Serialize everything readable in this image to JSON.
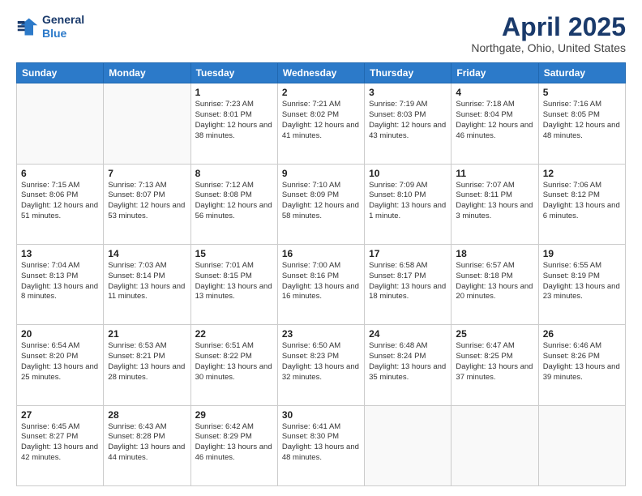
{
  "header": {
    "logo_line1": "General",
    "logo_line2": "Blue",
    "month": "April 2025",
    "location": "Northgate, Ohio, United States"
  },
  "weekdays": [
    "Sunday",
    "Monday",
    "Tuesday",
    "Wednesday",
    "Thursday",
    "Friday",
    "Saturday"
  ],
  "weeks": [
    [
      {
        "day": "",
        "info": ""
      },
      {
        "day": "",
        "info": ""
      },
      {
        "day": "1",
        "info": "Sunrise: 7:23 AM\nSunset: 8:01 PM\nDaylight: 12 hours and 38 minutes."
      },
      {
        "day": "2",
        "info": "Sunrise: 7:21 AM\nSunset: 8:02 PM\nDaylight: 12 hours and 41 minutes."
      },
      {
        "day": "3",
        "info": "Sunrise: 7:19 AM\nSunset: 8:03 PM\nDaylight: 12 hours and 43 minutes."
      },
      {
        "day": "4",
        "info": "Sunrise: 7:18 AM\nSunset: 8:04 PM\nDaylight: 12 hours and 46 minutes."
      },
      {
        "day": "5",
        "info": "Sunrise: 7:16 AM\nSunset: 8:05 PM\nDaylight: 12 hours and 48 minutes."
      }
    ],
    [
      {
        "day": "6",
        "info": "Sunrise: 7:15 AM\nSunset: 8:06 PM\nDaylight: 12 hours and 51 minutes."
      },
      {
        "day": "7",
        "info": "Sunrise: 7:13 AM\nSunset: 8:07 PM\nDaylight: 12 hours and 53 minutes."
      },
      {
        "day": "8",
        "info": "Sunrise: 7:12 AM\nSunset: 8:08 PM\nDaylight: 12 hours and 56 minutes."
      },
      {
        "day": "9",
        "info": "Sunrise: 7:10 AM\nSunset: 8:09 PM\nDaylight: 12 hours and 58 minutes."
      },
      {
        "day": "10",
        "info": "Sunrise: 7:09 AM\nSunset: 8:10 PM\nDaylight: 13 hours and 1 minute."
      },
      {
        "day": "11",
        "info": "Sunrise: 7:07 AM\nSunset: 8:11 PM\nDaylight: 13 hours and 3 minutes."
      },
      {
        "day": "12",
        "info": "Sunrise: 7:06 AM\nSunset: 8:12 PM\nDaylight: 13 hours and 6 minutes."
      }
    ],
    [
      {
        "day": "13",
        "info": "Sunrise: 7:04 AM\nSunset: 8:13 PM\nDaylight: 13 hours and 8 minutes."
      },
      {
        "day": "14",
        "info": "Sunrise: 7:03 AM\nSunset: 8:14 PM\nDaylight: 13 hours and 11 minutes."
      },
      {
        "day": "15",
        "info": "Sunrise: 7:01 AM\nSunset: 8:15 PM\nDaylight: 13 hours and 13 minutes."
      },
      {
        "day": "16",
        "info": "Sunrise: 7:00 AM\nSunset: 8:16 PM\nDaylight: 13 hours and 16 minutes."
      },
      {
        "day": "17",
        "info": "Sunrise: 6:58 AM\nSunset: 8:17 PM\nDaylight: 13 hours and 18 minutes."
      },
      {
        "day": "18",
        "info": "Sunrise: 6:57 AM\nSunset: 8:18 PM\nDaylight: 13 hours and 20 minutes."
      },
      {
        "day": "19",
        "info": "Sunrise: 6:55 AM\nSunset: 8:19 PM\nDaylight: 13 hours and 23 minutes."
      }
    ],
    [
      {
        "day": "20",
        "info": "Sunrise: 6:54 AM\nSunset: 8:20 PM\nDaylight: 13 hours and 25 minutes."
      },
      {
        "day": "21",
        "info": "Sunrise: 6:53 AM\nSunset: 8:21 PM\nDaylight: 13 hours and 28 minutes."
      },
      {
        "day": "22",
        "info": "Sunrise: 6:51 AM\nSunset: 8:22 PM\nDaylight: 13 hours and 30 minutes."
      },
      {
        "day": "23",
        "info": "Sunrise: 6:50 AM\nSunset: 8:23 PM\nDaylight: 13 hours and 32 minutes."
      },
      {
        "day": "24",
        "info": "Sunrise: 6:48 AM\nSunset: 8:24 PM\nDaylight: 13 hours and 35 minutes."
      },
      {
        "day": "25",
        "info": "Sunrise: 6:47 AM\nSunset: 8:25 PM\nDaylight: 13 hours and 37 minutes."
      },
      {
        "day": "26",
        "info": "Sunrise: 6:46 AM\nSunset: 8:26 PM\nDaylight: 13 hours and 39 minutes."
      }
    ],
    [
      {
        "day": "27",
        "info": "Sunrise: 6:45 AM\nSunset: 8:27 PM\nDaylight: 13 hours and 42 minutes."
      },
      {
        "day": "28",
        "info": "Sunrise: 6:43 AM\nSunset: 8:28 PM\nDaylight: 13 hours and 44 minutes."
      },
      {
        "day": "29",
        "info": "Sunrise: 6:42 AM\nSunset: 8:29 PM\nDaylight: 13 hours and 46 minutes."
      },
      {
        "day": "30",
        "info": "Sunrise: 6:41 AM\nSunset: 8:30 PM\nDaylight: 13 hours and 48 minutes."
      },
      {
        "day": "",
        "info": ""
      },
      {
        "day": "",
        "info": ""
      },
      {
        "day": "",
        "info": ""
      }
    ]
  ]
}
